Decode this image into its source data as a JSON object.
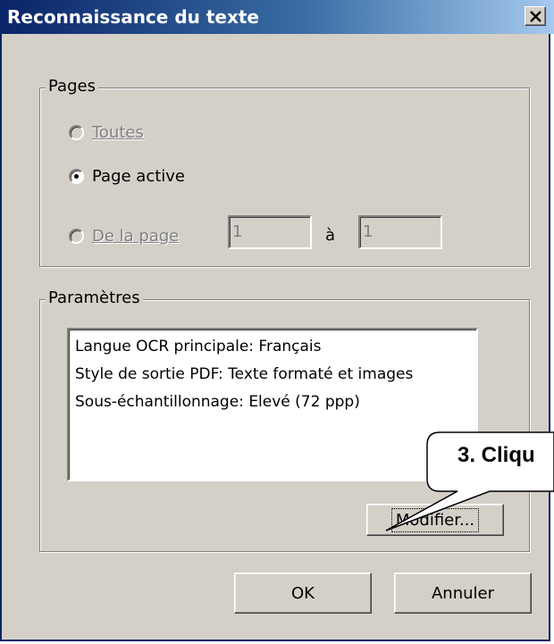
{
  "window": {
    "title": "Reconnaissance du texte",
    "close_icon": "close-icon"
  },
  "pages_group": {
    "legend": "Pages",
    "options": [
      {
        "label": "Toutes",
        "selected": false,
        "enabled": false
      },
      {
        "label": "Page active",
        "selected": true,
        "enabled": true
      },
      {
        "label": "De la page",
        "selected": false,
        "enabled": false
      }
    ],
    "from_value": "1",
    "to_label": "à",
    "to_value": "1"
  },
  "params_group": {
    "legend": "Paramètres",
    "lines": [
      "Langue OCR principale: Français",
      "Style de sortie PDF: Texte formaté et images",
      "Sous-échantillonnage: Elevé (72 ppp)"
    ],
    "modify_button": "Modifier..."
  },
  "buttons": {
    "ok": "OK",
    "cancel": "Annuler"
  },
  "callout": {
    "text": "3. Cliqu"
  }
}
